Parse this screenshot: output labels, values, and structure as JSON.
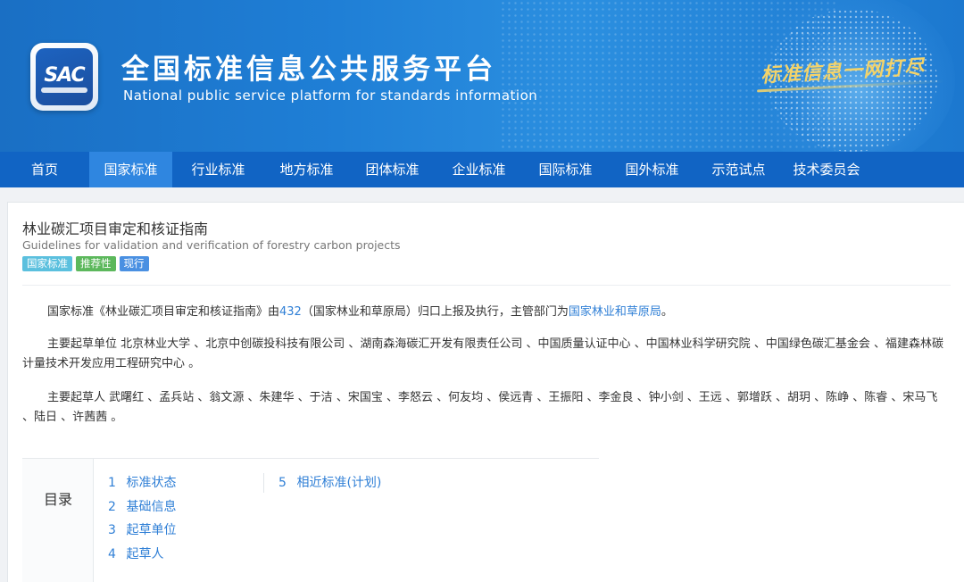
{
  "header": {
    "logo_text": "SAC",
    "title_cn": "全国标准信息公共服务平台",
    "title_en": "National public service platform  for standards information",
    "slogan": "标准信息一网打尽"
  },
  "nav": {
    "items": [
      "首页",
      "国家标准",
      "行业标准",
      "地方标准",
      "团体标准",
      "企业标准",
      "国际标准",
      "国外标准",
      "示范试点",
      "技术委员会"
    ],
    "active_index": 1
  },
  "standard": {
    "title": "林业碳汇项目审定和核证指南",
    "title_en": "Guidelines for validation and verification of forestry carbon projects",
    "tags": [
      "国家标准",
      "推荐性",
      "现行"
    ],
    "summary": {
      "prefix": "国家标准《林业碳汇项目审定和核证指南》由",
      "committee_code": "432",
      "middle": "（国家林业和草原局）归口上报及执行，主管部门为",
      "authority": "国家林业和草原局",
      "suffix": "。"
    },
    "drafting_units_label": "主要起草单位",
    "drafting_units": "北京林业大学 、北京中创碳投科技有限公司 、湖南森海碳汇开发有限责任公司 、中国质量认证中心 、中国林业科学研究院 、中国绿色碳汇基金会 、福建森林碳计量技术开发应用工程研究中心 。",
    "drafters_label": "主要起草人",
    "drafters": "武曙红 、孟兵站 、翁文源 、朱建华 、于洁 、宋国宝 、李怒云 、何友均 、侯远青 、王振阳 、李金良 、钟小剑 、王远 、郭增跃 、胡玥 、陈峥 、陈睿 、宋马飞 、陆日 、许茜茜 。"
  },
  "toc": {
    "label": "目录",
    "col1": [
      {
        "num": "1",
        "text": "标准状态"
      },
      {
        "num": "2",
        "text": "基础信息"
      },
      {
        "num": "3",
        "text": "起草单位"
      },
      {
        "num": "4",
        "text": "起草人"
      }
    ],
    "col2": [
      {
        "num": "5",
        "text": "相近标准(计划)"
      }
    ]
  },
  "colors": {
    "nav_bg": "#1164c4",
    "nav_active": "#2f86e0",
    "link": "#2f7fd6",
    "tag_national": "#5bc0de",
    "tag_recommended": "#5cb85c",
    "tag_current": "#4a90e2"
  }
}
